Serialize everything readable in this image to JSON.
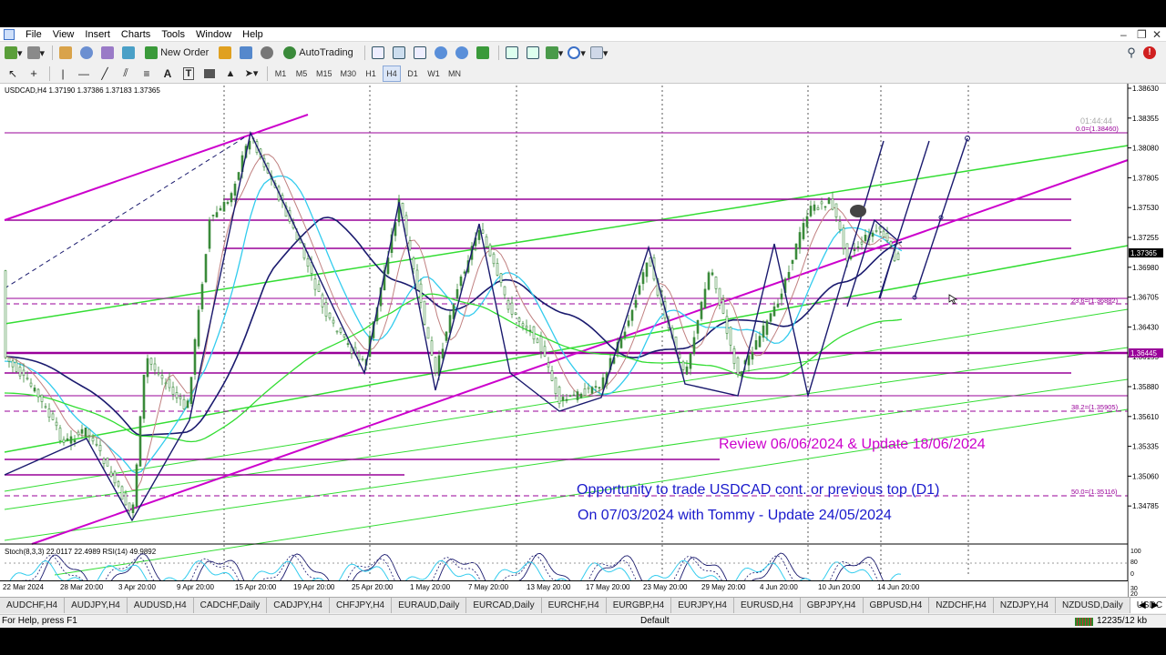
{
  "menu": [
    "File",
    "View",
    "Insert",
    "Charts",
    "Tools",
    "Window",
    "Help"
  ],
  "toolbar": {
    "new_order_label": "New Order",
    "autotrading_label": "AutoTrading",
    "timeframes": [
      "M1",
      "M5",
      "M15",
      "M30",
      "H1",
      "H4",
      "D1",
      "W1",
      "MN"
    ],
    "active_timeframe": "H4"
  },
  "chart": {
    "info": "USDCAD,H4  1.37190 1.37386 1.37183 1.37365",
    "timer": "01:44:44",
    "current_price": "1.37365",
    "level_price_tag": "1.36445",
    "price_ticks": [
      "1.38630",
      "1.38355",
      "1.38080",
      "1.37805",
      "1.37530",
      "1.37255",
      "1.36980",
      "1.36705",
      "1.36430",
      "1.36155",
      "1.35880",
      "1.35610",
      "1.35335",
      "1.35060",
      "1.34785"
    ],
    "time_ticks": [
      "22 Mar 2024",
      "28 Mar 20:00",
      "3 Apr 20:00",
      "9 Apr 20:00",
      "15 Apr 20:00",
      "19 Apr 20:00",
      "25 Apr 20:00",
      "1 May 20:00",
      "7 May 20:00",
      "13 May 20:00",
      "17 May 20:00",
      "23 May 20:00",
      "29 May 20:00",
      "4 Jun 20:00",
      "10 Jun 20:00",
      "14 Jun 20:00"
    ],
    "fib_labels": [
      "0.0=(1.38460)",
      "23.6=(1.36882)",
      "38.2=(1.35905)",
      "50.0=(1.35116)"
    ],
    "annotations": {
      "review": "Review 06/06/2024 & Update 18/06/2024",
      "opportunity": "Opportunity to trade USDCAD cont. or previous top (D1)",
      "date_line": "On 07/03/2024 with Tommy - Update 24/05/2024"
    },
    "indicator_label": "Stoch(8,3,3) 22.0117 22.4989  RSI(14) 49.9892",
    "indicator_ticks": [
      "100",
      "80",
      "30",
      "20",
      "0"
    ],
    "colors": {
      "magenta": "#cc00cc",
      "purple": "#990099",
      "green": "#33dd33",
      "dark_blue": "#1a1a6e",
      "cyan": "#33ccee",
      "text_blue": "#1a1acc"
    }
  },
  "tabs": [
    "AUDCHF,H4",
    "AUDJPY,H4",
    "AUDUSD,H4",
    "CADCHF,Daily",
    "CADJPY,H4",
    "CHFJPY,H4",
    "EURAUD,Daily",
    "EURCAD,Daily",
    "EURCHF,H4",
    "EURGBP,H4",
    "EURJPY,H4",
    "EURUSD,H4",
    "GBPJPY,H4",
    "GBPUSD,H4",
    "NZDCHF,H4",
    "NZDJPY,H4",
    "NZDUSD,Daily",
    "USDC"
  ],
  "active_tab": "USDC",
  "status": {
    "help": "For Help, press F1",
    "profile": "Default",
    "traffic": "12235/12 kb"
  }
}
